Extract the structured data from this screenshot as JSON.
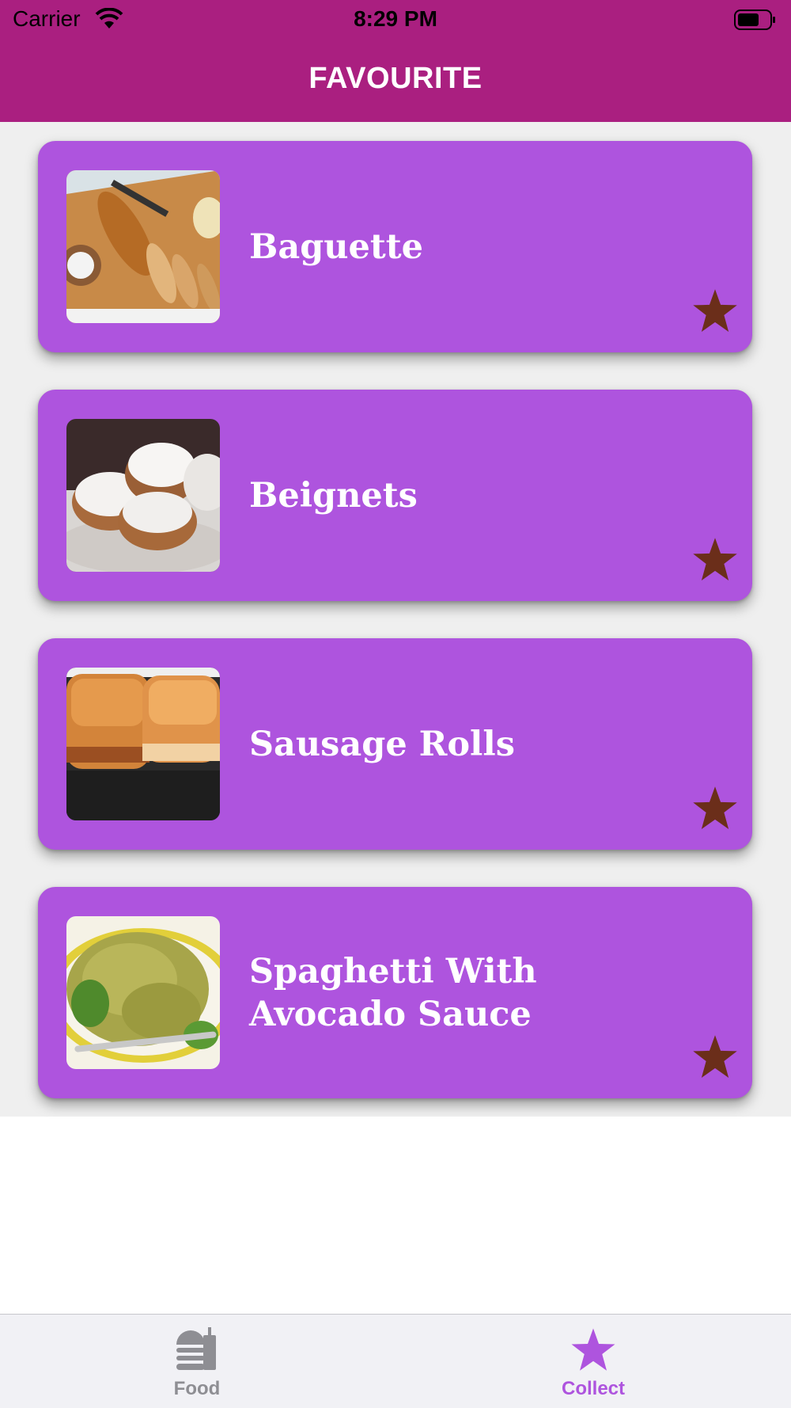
{
  "status_bar": {
    "carrier": "Carrier",
    "time": "8:29 PM"
  },
  "nav": {
    "title": "FAVOURITE"
  },
  "colors": {
    "header": "#aa1f80",
    "card": "#ae54de",
    "star": "#6b2e1a",
    "tab_active": "#ae54de",
    "tab_inactive": "#8e8e93"
  },
  "favourites": [
    {
      "name": "Baguette",
      "image": "baguette-photo",
      "favourited": true
    },
    {
      "name": "Beignets",
      "image": "beignets-photo",
      "favourited": true
    },
    {
      "name": "Sausage Rolls",
      "image": "sausage-rolls-photo",
      "favourited": true
    },
    {
      "name": "Spaghetti With Avocado Sauce",
      "image": "spaghetti-photo",
      "favourited": true
    }
  ],
  "tab_bar": {
    "tabs": [
      {
        "label": "Food",
        "icon": "food-icon",
        "selected": false
      },
      {
        "label": "Collect",
        "icon": "star-icon",
        "selected": true
      }
    ]
  }
}
